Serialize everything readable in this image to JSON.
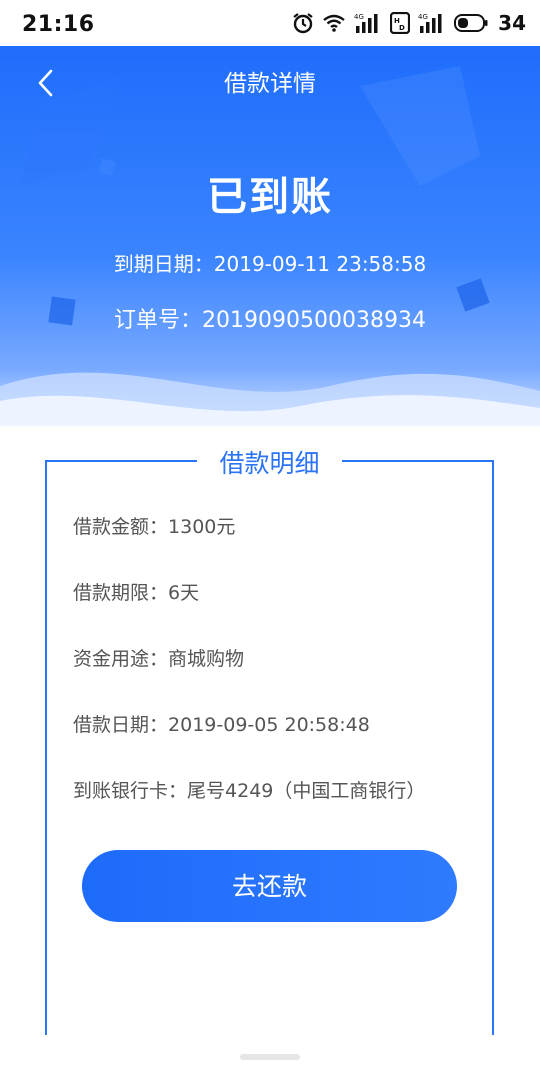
{
  "status_bar": {
    "time": "21:16",
    "battery_level": "34",
    "icons": [
      "alarm-icon",
      "wifi-icon",
      "signal-4g-icon",
      "hd-icon",
      "signal-4g-icon-2",
      "battery-icon"
    ]
  },
  "header": {
    "title": "借款详情",
    "back_icon": "chevron-left-icon"
  },
  "hero": {
    "status": "已到账",
    "due_date_text": "到期日期：2019-09-11 23:58:58",
    "order_number_text": "订单号：2019090500038934"
  },
  "card": {
    "title": "借款明细",
    "rows": [
      {
        "label": "借款金额：",
        "value": "1300元"
      },
      {
        "label": "借款期限：",
        "value": "6天"
      },
      {
        "label": "资金用途：",
        "value": "商城购物"
      },
      {
        "label": "借款日期：",
        "value": "2019-09-05 20:58:48"
      },
      {
        "label": "到账银行卡：",
        "value": "尾号4249（中国工商银行）"
      }
    ]
  },
  "actions": {
    "repay_label": "去还款"
  },
  "colors": {
    "primary": "#2c74f6",
    "hero_top": "#1f6dfb",
    "text_gray": "#555555"
  }
}
